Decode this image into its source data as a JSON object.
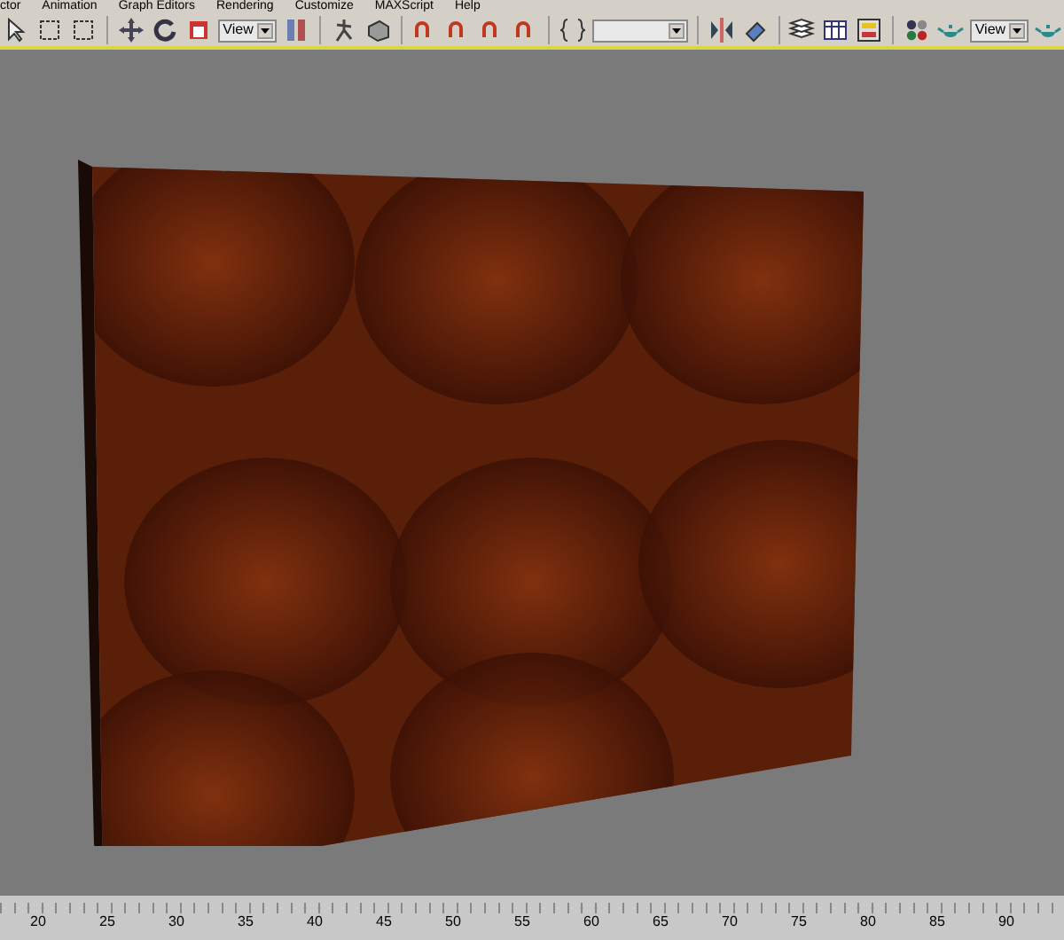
{
  "menu": [
    "ctor",
    "Animation",
    "Graph Editors",
    "Rendering",
    "Customize",
    "MAXScript",
    "Help"
  ],
  "toolbar": {
    "reference_coordinate_dropdown": "View",
    "render_type_dropdown": "View"
  },
  "ruler": {
    "labels": [
      "20",
      "25",
      "30",
      "35",
      "40",
      "45",
      "50",
      "55",
      "60",
      "65",
      "70",
      "75",
      "80",
      "85",
      "90"
    ]
  }
}
